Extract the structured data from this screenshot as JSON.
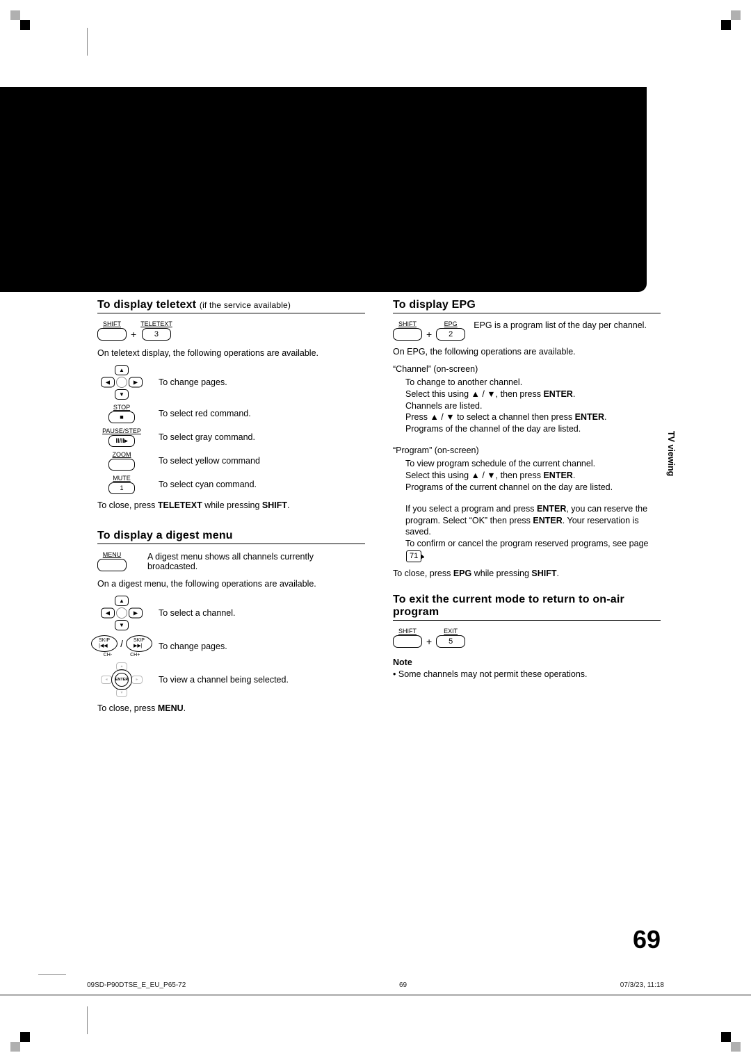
{
  "blackBarPresent": true,
  "left": {
    "teletext": {
      "title": "To display teletext",
      "title_sub": "(if the service available)",
      "keys": {
        "k1_label": "SHIFT",
        "k2_label": "TELETEXT",
        "k2_num": "3"
      },
      "intro": "On teletext display, the following operations are available.",
      "ops": {
        "change_pages": "To change pages.",
        "stop_label": "STOP",
        "red": "To select red command.",
        "pause_label": "PAUSE/STEP",
        "gray": "To select gray command.",
        "zoom_label": "ZOOM",
        "yellow": "To select yellow command",
        "mute_label": "MUTE",
        "mute_num": "1",
        "cyan": "To select cyan command."
      },
      "close": "To close, press TELETEXT while pressing SHIFT."
    },
    "digest": {
      "title": "To display a digest menu",
      "menu_label": "MENU",
      "intro_side": "A digest menu shows all channels currently broadcasted.",
      "intro": "On a digest menu, the following operations are available.",
      "ops": {
        "select_channel": "To select a channel.",
        "change_pages": "To change pages.",
        "enter_label": "ENTER",
        "view_channel": "To view a channel being selected."
      },
      "close": "To close, press MENU."
    }
  },
  "right": {
    "epg": {
      "title": "To display EPG",
      "keys": {
        "k1_label": "SHIFT",
        "k2_label": "EPG",
        "k2_num": "2"
      },
      "side_text": "EPG is a program list of the day per channel.",
      "intro": "On EPG, the following operations are available.",
      "channel_head": "“Channel” (on-screen)",
      "channel_l1": "To change to another channel.",
      "channel_l2a": "Select this using ",
      "channel_l2b": " / ",
      "channel_l2c": ", then press ENTER.",
      "channel_l3": "Channels are listed.",
      "channel_l4a": "Press ",
      "channel_l4b": " / ",
      "channel_l4c": " to select a channel then press ENTER.",
      "channel_l5": "Programs of the channel of the day are listed.",
      "program_head": "“Program”  (on-screen)",
      "program_l1": "To view program schedule of the current channel.",
      "program_l2a": "Select this using ",
      "program_l2b": " / ",
      "program_l2c": ", then press ENTER.",
      "program_l3": "Programs of the current channel on the day are listed.",
      "reserve_l1": "If you select a program and press ENTER, you can reserve the program. Select “OK” then press ENTER. Your reservation is saved.",
      "reserve_l2a": "To confirm or cancel the program reserved programs, see page ",
      "reserve_page": "71",
      "reserve_l2b": ".",
      "close": "To close, press EPG while pressing SHIFT."
    },
    "exit": {
      "title": "To exit the current mode to return to on-air program",
      "keys": {
        "k1_label": "SHIFT",
        "k2_label": "EXIT",
        "k2_num": "5"
      }
    },
    "note": {
      "title": "Note",
      "item": "Some channels may not permit these operations."
    }
  },
  "side_tab": "TV viewing",
  "page_number": "69",
  "footer": {
    "left": "09SD-P90DTSE_E_EU_P65-72",
    "center": "69",
    "right": "07/3/23, 11:18"
  }
}
